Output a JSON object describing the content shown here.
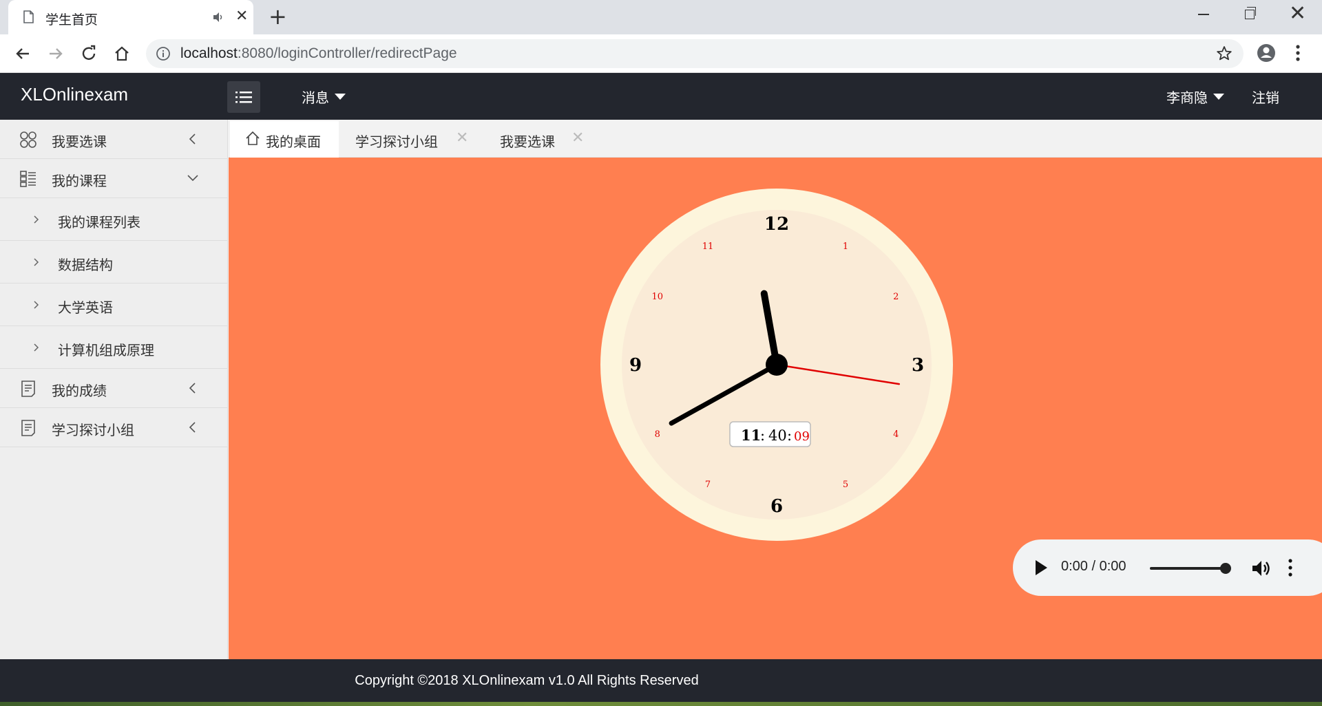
{
  "browser": {
    "tab_title": "学生首页",
    "url_host": "localhost",
    "url_path": ":8080/loginController/redirectPage"
  },
  "header": {
    "logo": "XLOnlinexam",
    "messages": "消息",
    "user": "李商隐",
    "logout": "注销"
  },
  "sidebar": {
    "items": [
      {
        "label": "我要选课",
        "icon": "grid-icon",
        "expanded": false
      },
      {
        "label": "我的课程",
        "icon": "list-icon",
        "expanded": true,
        "children": [
          "我的课程列表",
          "数据结构",
          "大学英语",
          "计算机组成原理"
        ]
      },
      {
        "label": "我的成绩",
        "icon": "document-icon",
        "expanded": false
      },
      {
        "label": "学习探讨小组",
        "icon": "document-icon",
        "expanded": false
      }
    ]
  },
  "content_tabs": [
    "我的桌面",
    "学习探讨小组",
    "我要选课"
  ],
  "clock": {
    "major_numbers": [
      "12",
      "3",
      "6",
      "9"
    ],
    "minor_numbers": [
      "1",
      "2",
      "4",
      "5",
      "7",
      "8",
      "10",
      "11"
    ],
    "time": {
      "hours": "11",
      "minutes": "40",
      "seconds": "09"
    },
    "hand_color": "#000000",
    "second_hand_color": "#e00000"
  },
  "audio": {
    "time": "0:00 / 0:00",
    "volume": 1.0
  },
  "footer": {
    "copyright": "Copyright ©2018 XLOnlinexam v1.0 All Rights Reserved"
  },
  "colors": {
    "header_bg": "#23262e",
    "content_bg": "#ff7f50",
    "clock_rim": "#fdf5dc",
    "clock_face": "#faebd7"
  }
}
